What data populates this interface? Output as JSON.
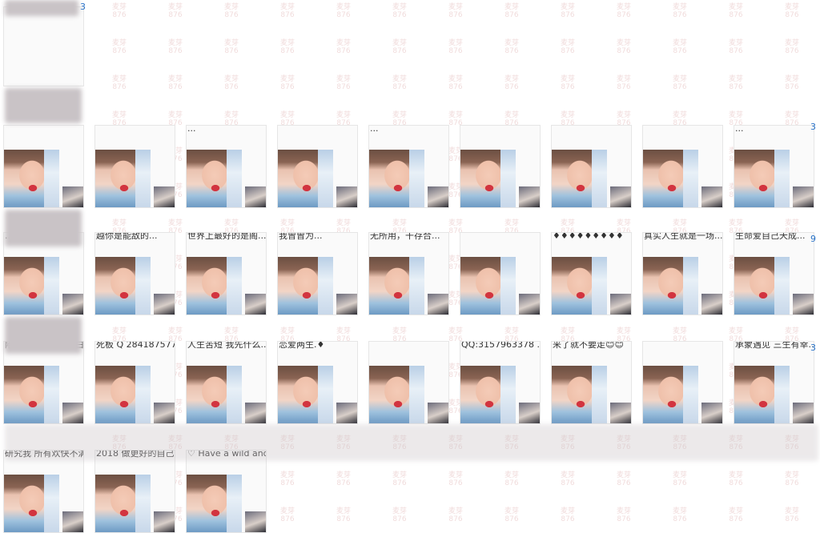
{
  "rows": [
    {
      "cards": [
        {
          "caption": ""
        }
      ]
    },
    {
      "cards": [
        {
          "caption": ""
        },
        {
          "caption": ""
        },
        {
          "caption": "..."
        },
        {
          "caption": ""
        },
        {
          "caption": "..."
        },
        {
          "caption": ""
        },
        {
          "caption": ""
        },
        {
          "caption": ""
        },
        {
          "caption": "..."
        }
      ]
    },
    {
      "cards": [
        {
          "caption": "........"
        },
        {
          "caption": "越你是能敌的..."
        },
        {
          "caption": "世界上最好的是阁..."
        },
        {
          "caption": "我曾曾为..."
        },
        {
          "caption": "无所用，干存合..."
        },
        {
          "caption": ""
        },
        {
          "caption": "♦♦♦♦♦♦♦♦♦"
        },
        {
          "caption": "真实人生就是一场..."
        },
        {
          "caption": "生命爱自己天成..."
        }
      ]
    },
    {
      "cards": [
        {
          "caption": "陪伴是最长久的告白"
        },
        {
          "caption": "死板 Q 2841875778"
        },
        {
          "caption": "人生苦短 我先什么..."
        },
        {
          "caption": "恋爱两生.♦"
        },
        {
          "caption": ""
        },
        {
          "caption": "QQ:3157963378 ..."
        },
        {
          "caption": "来了就不要走😊😊"
        },
        {
          "caption": ""
        },
        {
          "caption": "承蒙遇见 三生有幸..."
        }
      ]
    },
    {
      "cards": [
        {
          "caption": "研究我 所有欢快不满"
        },
        {
          "caption": "2018 做更好的自己..."
        },
        {
          "caption": "♡ Have a wild and..."
        }
      ]
    }
  ],
  "side_counts": [
    "3",
    "3",
    "9",
    "3"
  ],
  "watermark": {
    "line1": "麦芽",
    "line2": "876"
  },
  "colors": {
    "accent": "#2a73c8",
    "card_border": "#e6e6e6",
    "watermark": "#f1dcdc"
  }
}
